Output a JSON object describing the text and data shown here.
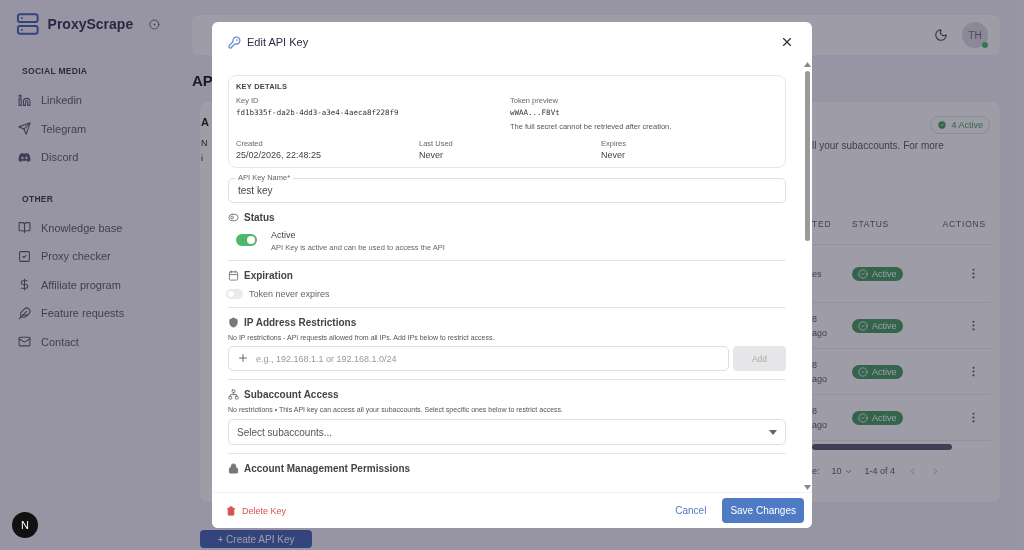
{
  "sidebar": {
    "brand": "ProxyScrape",
    "sections": [
      {
        "title": "SOCIAL MEDIA",
        "items": [
          {
            "label": "Linkedin"
          },
          {
            "label": "Telegram"
          },
          {
            "label": "Discord"
          }
        ]
      },
      {
        "title": "OTHER",
        "items": [
          {
            "label": "Knowledge base"
          },
          {
            "label": "Proxy checker"
          },
          {
            "label": "Affiliate program"
          },
          {
            "label": "Feature requests"
          },
          {
            "label": "Contact"
          }
        ]
      }
    ]
  },
  "header": {
    "avatar": "TH",
    "online": true
  },
  "page": {
    "title_fragment": "AP",
    "card_title_fragment": "A",
    "description_fragments": [
      "N",
      "i"
    ],
    "badge": "4 Active",
    "description_tail": "ll your subaccounts. For more",
    "table": {
      "columns": [
        "TED",
        "STATUS",
        "ACTIONS"
      ],
      "rows": [
        {
          "cells": [
            "es"
          ],
          "status": "Active"
        },
        {
          "cells": [
            "8",
            "ago"
          ],
          "status": "Active"
        },
        {
          "cells": [
            "8",
            "ago"
          ],
          "status": "Active"
        },
        {
          "cells": [
            "8",
            "ago"
          ],
          "status": "Active"
        }
      ]
    },
    "pagination": {
      "label_fragment": "e:",
      "per_page": "10",
      "range": "1-4 of 4"
    },
    "create_button": "+ Create API Key"
  },
  "dev_badge": "N",
  "modal": {
    "title": "Edit API Key",
    "details": {
      "heading": "KEY DETAILS",
      "fields": [
        {
          "label": "Key ID",
          "value": "fd1b335f-da2b-4dd3-a3e4-4aeca8f228f9"
        },
        {
          "label": "Token preview",
          "value": "wWAA...F8Vt",
          "note": "The full secret cannot be retrieved after creation."
        }
      ],
      "meta": [
        {
          "label": "Created",
          "value": "25/02/2026, 22:48:25"
        },
        {
          "label": "Last Used",
          "value": "Never"
        },
        {
          "label": "Expires",
          "value": "Never"
        }
      ]
    },
    "name_field": {
      "label": "API Key Name*",
      "value": "test key"
    },
    "sections": [
      {
        "kind": "toggle",
        "title": "Status",
        "toggle": {
          "on": true,
          "label": "Active",
          "description": "API Key is active and can be used to access the API"
        }
      },
      {
        "kind": "toggle",
        "title": "Expiration",
        "toggle": {
          "on": false,
          "label": "Token never expires"
        }
      },
      {
        "kind": "ip",
        "title": "IP Address Restrictions",
        "description": "No IP restrictions - API requests allowed from all IPs. Add IPs below to restrict access.",
        "placeholder": "e.g., 192.168.1.1 or 192.168.1.0/24",
        "button": {
          "label": "Add",
          "disabled": true
        }
      },
      {
        "kind": "select",
        "title": "Subaccount Access",
        "description": "No restrictions • This API key can access all your subaccounts. Select specific ones below to restrict access.",
        "placeholder": "Select subaccounts..."
      },
      {
        "kind": "heading",
        "title": "Account Management Permissions"
      }
    ],
    "footer": {
      "delete": "Delete Key",
      "cancel": "Cancel",
      "save": "Save Changes"
    }
  }
}
